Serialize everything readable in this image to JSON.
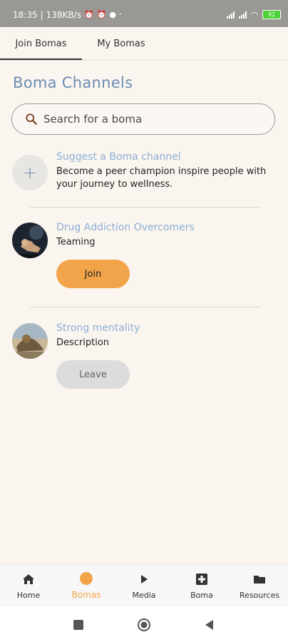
{
  "status_bar": {
    "time": "18:35",
    "net_speed": "138KB/s",
    "battery": "92"
  },
  "tabs": [
    {
      "label": "Join Bomas"
    },
    {
      "label": "My Bomas"
    }
  ],
  "page_title": "Boma Channels",
  "search": {
    "placeholder": "Search for a boma"
  },
  "suggest": {
    "title": "Suggest a Boma channel",
    "description": "Become a peer champion  inspire people with your  journey to wellness."
  },
  "channels": [
    {
      "title": "Drug Addiction Overcomers",
      "description": "Teaming",
      "button": "Join"
    },
    {
      "title": "Strong mentality",
      "description": "Description",
      "button": "Leave"
    }
  ],
  "bottom_nav": [
    {
      "label": "Home",
      "icon": "home-icon"
    },
    {
      "label": "Bomas",
      "icon": "bomas-icon"
    },
    {
      "label": "Media",
      "icon": "play-icon"
    },
    {
      "label": "Boma",
      "icon": "medical-cross-icon"
    },
    {
      "label": "Resources",
      "icon": "folder-icon"
    }
  ],
  "colors": {
    "accent": "#f2a44b",
    "title_blue": "#6c8db3",
    "link_blue": "#8cb0d6",
    "background": "#faf5ef"
  }
}
